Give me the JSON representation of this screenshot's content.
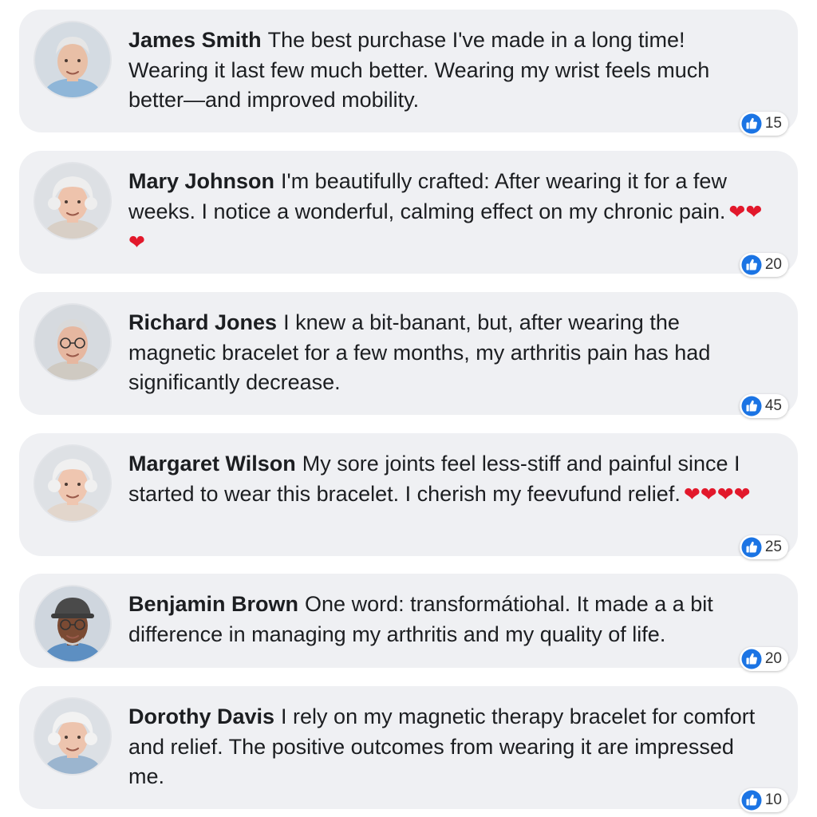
{
  "comments": [
    {
      "author": "James Smith",
      "text": "The best purchase I've made in a long time! Wearing it last few much better. Wearing my wrist feels much better—and improved mobility.",
      "hearts": "",
      "likes": "15",
      "avatar": "elderly-man-avatar",
      "skin": "#e8bfa6",
      "hair": "#e6e6e6",
      "shirt": "#8fb6d8",
      "bg": "#d4dbe2"
    },
    {
      "author": "Mary Johnson",
      "text": "I'm beautifully crafted: After wearing it for a few weeks. I notice a wonderful, calming effect on my chronic pain.",
      "hearts": "❤❤❤",
      "likes": "20",
      "avatar": "elderly-woman-avatar",
      "skin": "#eec3ac",
      "hair": "#eeeeee",
      "shirt": "#d8cfc6",
      "bg": "#dde0e4"
    },
    {
      "author": "Richard Jones",
      "text": "I knew a bit-banant, but, after wearing the magnetic bracelet for a few months, my arthritis pain has had significantly decrease.",
      "hearts": "",
      "likes": "45",
      "avatar": "elderly-man-glasses-avatar",
      "skin": "#e6b7a0",
      "hair": "#d9d9d9",
      "shirt": "#cfcac2",
      "bg": "#d6dadf"
    },
    {
      "author": "Margaret Wilson",
      "text": "My sore joints feel less-stiff and painful since I started to wear this bracelet. I cherish my feevufund relief.",
      "hearts": "❤❤❤❤",
      "likes": "25",
      "avatar": "elderly-woman-avatar",
      "skin": "#efc6b0",
      "hair": "#f0f0f0",
      "shirt": "#e2d6cc",
      "bg": "#dee1e5"
    },
    {
      "author": "Benjamin Brown",
      "text": "One word: transformátiohal. It made a a bit difference in managing my arthritis and my quality of life.",
      "hearts": "",
      "likes": "20",
      "avatar": "man-cap-avatar",
      "skin": "#7a4a33",
      "hair": "#3a3a3a",
      "shirt": "#5d8fc2",
      "bg": "#cfd6de"
    },
    {
      "author": "Dorothy Davis",
      "text": "I rely on my magnetic therapy bracelet for comfort and relief. The positive outcomes from wearing it are impressed me.",
      "hearts": "",
      "likes": "10",
      "avatar": "elderly-woman-avatar",
      "skin": "#edc4ae",
      "hair": "#f2f2f2",
      "shirt": "#9bb5cf",
      "bg": "#dce0e5"
    }
  ],
  "reaction_icon": "thumbs-up-icon",
  "colors": {
    "bubble": "#eff0f3",
    "like_blue": "#1b74e4",
    "heart_red": "#e2182b",
    "text": "#1c1e21"
  }
}
